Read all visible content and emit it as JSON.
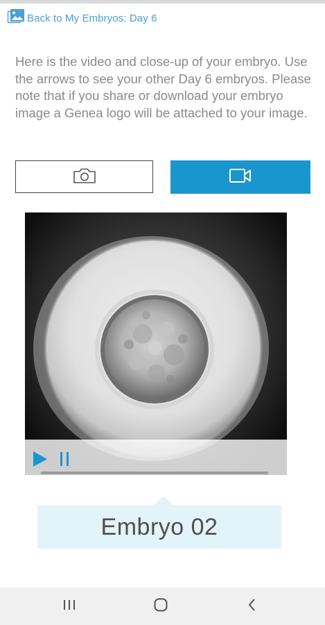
{
  "header": {
    "back_label": "Back to My Embryos: Day 6",
    "back_icon": "gallery-image-icon",
    "accent_color": "#4a9fd4"
  },
  "intro": {
    "text": "Here is the video and close-up of your embryo. Use the arrows to see your other Day 6 embryos. Please note that if you share or download your embryo image a Genea logo will be attached to your image."
  },
  "view_toggle": {
    "photo_icon": "camera-icon",
    "video_icon": "video-camera-icon",
    "selected": "video",
    "selected_color": "#1a96cf"
  },
  "player": {
    "play_icon": "play-icon",
    "pause_icon": "pause-icon",
    "control_color": "#1a96cf",
    "progress": 0
  },
  "embryo": {
    "name": "Embryo 02"
  },
  "system_nav": {
    "recents_icon": "recent-apps-icon",
    "home_icon": "home-icon",
    "back_icon": "back-chevron-icon"
  }
}
